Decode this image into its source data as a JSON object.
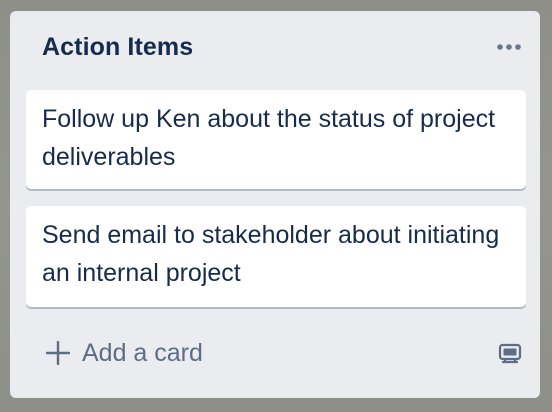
{
  "list": {
    "title": "Action Items",
    "menu_icon": "more-horizontal-icon",
    "cards": [
      {
        "title": "Follow up Ken about the status of project deliverables"
      },
      {
        "title": "Send email to stakeholder about initiating an internal project"
      }
    ],
    "add_card_label": "Add a card",
    "add_card_icon": "plus-icon",
    "template_icon": "card-template-icon"
  },
  "colors": {
    "board_background": "#8d8f88",
    "list_background": "#ebecf0",
    "card_background": "#ffffff",
    "title_text": "#172b4d",
    "muted_text": "#5e6c84"
  }
}
